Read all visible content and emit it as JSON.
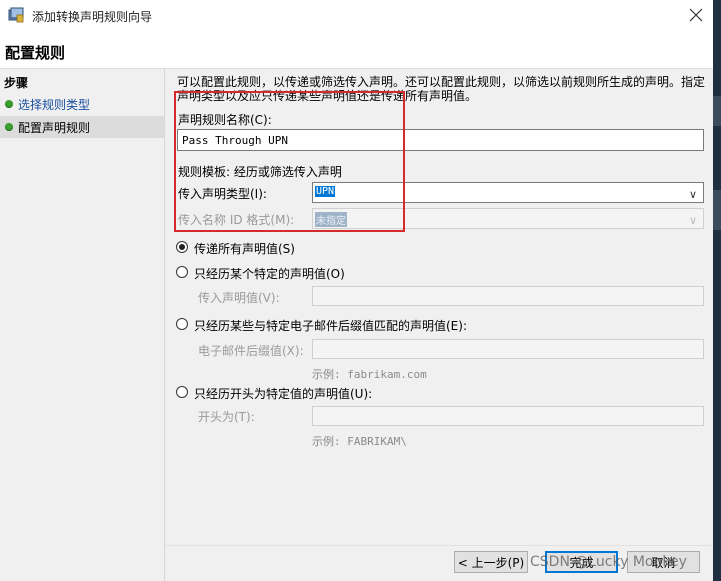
{
  "window": {
    "title": "添加转换声明规则向导",
    "close_icon": "close-icon"
  },
  "page_title": "配置规则",
  "sidebar": {
    "heading": "步骤",
    "steps": [
      {
        "label": "选择规则类型",
        "status": "completed",
        "link": true
      },
      {
        "label": "配置声明规则",
        "status": "current"
      }
    ]
  },
  "main": {
    "description": "可以配置此规则，以传递或筛选传入声明。还可以配置此规则，以筛选以前规则所生成的声明。指定声明类型以及应只传递某些声明值还是传递所有声明值。",
    "rule_name_label": "声明规则名称(C):",
    "rule_name_value": "Pass Through UPN",
    "template_label": "规则模板: 经历或筛选传入声明",
    "incoming_type_label": "传入声明类型(I):",
    "incoming_type_value": "UPN",
    "name_id_label": "传入名称 ID 格式(M):",
    "name_id_value": "未指定",
    "options": [
      {
        "label": "传递所有声明值(S)",
        "checked": true
      },
      {
        "label": "只经历某个特定的声明值(O)",
        "checked": false
      },
      {
        "label": "只经历某些与特定电子邮件后缀值匹配的声明值(E):",
        "checked": false
      },
      {
        "label": "只经历开头为特定值的声明值(U):",
        "checked": false
      }
    ],
    "incoming_value_label": "传入声明值(V):",
    "email_suffix_label": "电子邮件后缀值(X):",
    "email_example": "示例: fabrikam.com",
    "starts_with_label": "开头为(T):",
    "starts_with_example": "示例: FABRIKAM\\"
  },
  "footer": {
    "back_label": "< 上一步(P)",
    "finish_label": "完成",
    "cancel_label": "取消"
  },
  "watermark": "CSDN @Lucky Monkey",
  "colors": {
    "accent": "#0078d7",
    "highlight_box": "#d42a2a",
    "step_dot": "#3c9e2f"
  }
}
